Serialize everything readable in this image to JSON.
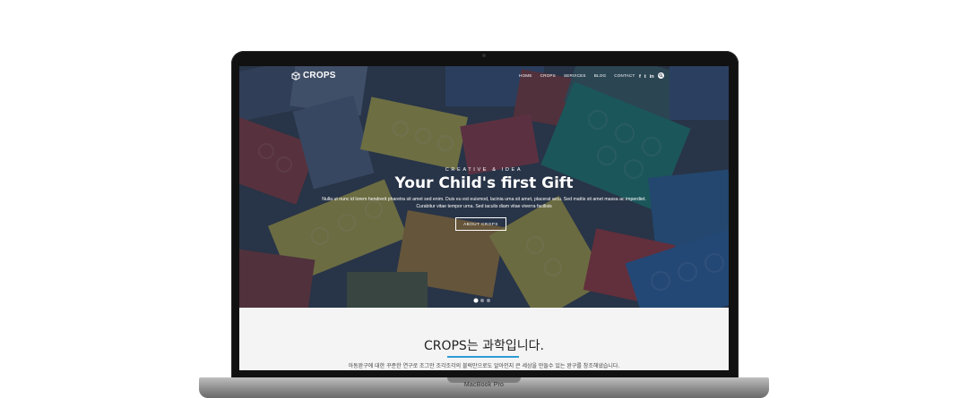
{
  "device": {
    "model_label": "MacBook Pro"
  },
  "header": {
    "logo_text": "CROPS",
    "nav": [
      "HOME",
      "CROPS",
      "SERVICES",
      "BLOG",
      "CONTACT"
    ],
    "social": [
      {
        "name": "facebook-icon",
        "glyph": "f"
      },
      {
        "name": "twitter-icon",
        "glyph": "t"
      },
      {
        "name": "linkedin-icon",
        "glyph": "in"
      }
    ]
  },
  "hero": {
    "eyebrow": "CREATIVE & IDEA",
    "headline": "Your Child's first Gift",
    "body": "Nulla ut nunc id lorem hendrerit pharetra sit amet sed enim. Duis eu est euismod, lacinia urna sit amet, placerat arcu. Sed mattis sit amet massa ac imperdiet. Curabitur vitae tempor urna. Sed iaculis diam vitae viverra facilisis",
    "cta_label": "ABOUT CROPS",
    "slides": 3,
    "active_slide": 1
  },
  "about": {
    "title": "CROPS는 과학입니다.",
    "description": "아동완구에 대한 꾸준한 연구로 조그만 조각조각의 블럭만으로도 알아인지 큰 세상을 만들수 있는 완구를 창조해냈습니다.",
    "accent_color": "#2e9bd6"
  }
}
